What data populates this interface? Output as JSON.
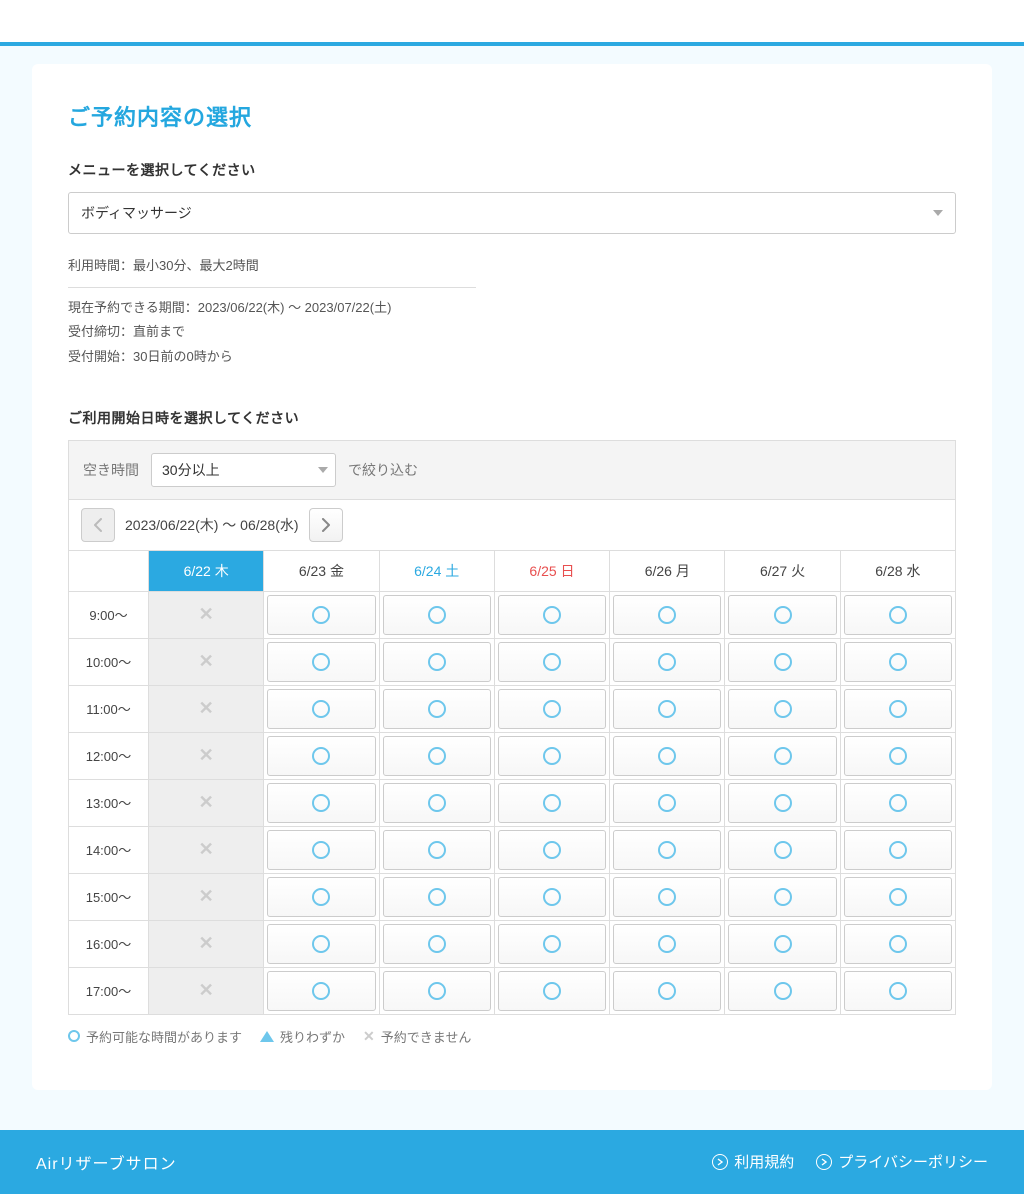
{
  "page_title": "ご予約内容の選択",
  "menu": {
    "label": "メニューを選択してください",
    "selected": "ボディマッサージ"
  },
  "details": {
    "usage_duration": "利用時間：最小30分、最大2時間",
    "available_period": "現在予約できる期間：2023/06/22(木) 〜 2023/07/22(土)",
    "deadline": "受付締切：直前まで",
    "start": "受付開始：30日前の0時から"
  },
  "datetime_label": "ご利用開始日時を選択してください",
  "filter": {
    "label": "空き時間",
    "selected": "30分以上",
    "suffix": "で絞り込む"
  },
  "nav": {
    "range": "2023/06/22(木) 〜 06/28(水)"
  },
  "calendar": {
    "headers": [
      {
        "label": "6/22 木",
        "kind": "today"
      },
      {
        "label": "6/23 金",
        "kind": ""
      },
      {
        "label": "6/24 土",
        "kind": "sat"
      },
      {
        "label": "6/25 日",
        "kind": "sun"
      },
      {
        "label": "6/26 月",
        "kind": ""
      },
      {
        "label": "6/27 火",
        "kind": ""
      },
      {
        "label": "6/28 水",
        "kind": ""
      }
    ],
    "timeslots": [
      "9:00〜",
      "10:00〜",
      "11:00〜",
      "12:00〜",
      "13:00〜",
      "14:00〜",
      "15:00〜",
      "16:00〜",
      "17:00〜"
    ],
    "grid": [
      [
        "x",
        "o",
        "o",
        "o",
        "o",
        "o",
        "o"
      ],
      [
        "x",
        "o",
        "o",
        "o",
        "o",
        "o",
        "o"
      ],
      [
        "x",
        "o",
        "o",
        "o",
        "o",
        "o",
        "o"
      ],
      [
        "x",
        "o",
        "o",
        "o",
        "o",
        "o",
        "o"
      ],
      [
        "x",
        "o",
        "o",
        "o",
        "o",
        "o",
        "o"
      ],
      [
        "x",
        "o",
        "o",
        "o",
        "o",
        "o",
        "o"
      ],
      [
        "x",
        "o",
        "o",
        "o",
        "o",
        "o",
        "o"
      ],
      [
        "x",
        "o",
        "o",
        "o",
        "o",
        "o",
        "o"
      ],
      [
        "x",
        "o",
        "o",
        "o",
        "o",
        "o",
        "o"
      ]
    ]
  },
  "legend": {
    "available": "予約可能な時間があります",
    "few": "残りわずか",
    "unavailable": "予約できません"
  },
  "footer": {
    "brand": "Airリザーブサロン",
    "terms": "利用規約",
    "privacy": "プライバシーポリシー"
  }
}
